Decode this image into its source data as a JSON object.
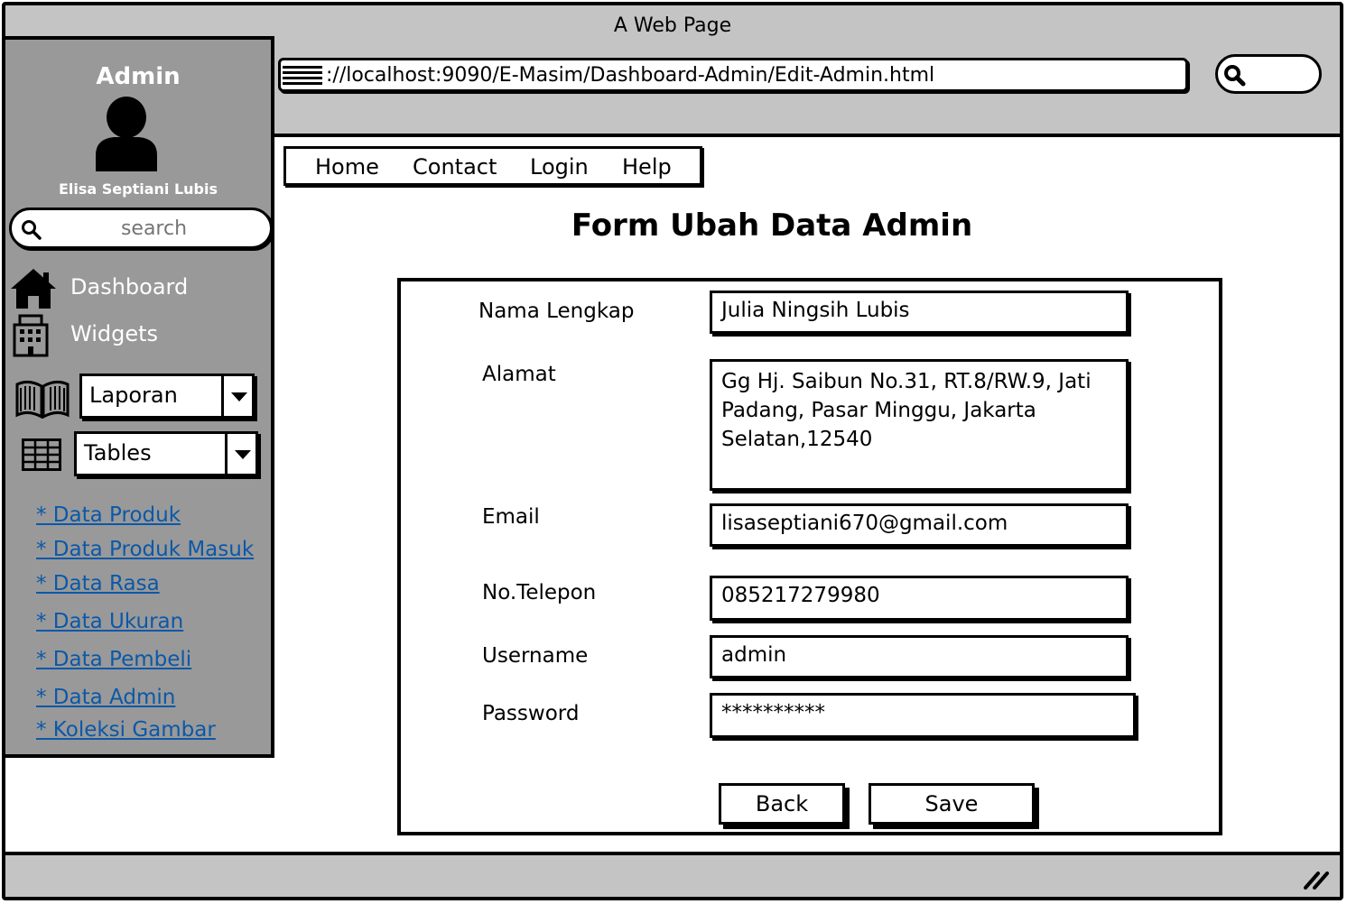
{
  "window": {
    "title": "A Web Page"
  },
  "browser": {
    "url": "http://localhost:9090/E-Masim/Dashboard-Admin/Edit-Admin.html",
    "url_visible": "://localhost:9090/E-Masim/Dashboard-Admin/Edit-Admin.html"
  },
  "sidebar": {
    "title": "Admin",
    "user_name": "Elisa Septiani Lubis",
    "search_placeholder": "search",
    "nav": [
      {
        "label": "Dashboard",
        "icon": "home-icon"
      },
      {
        "label": "Widgets",
        "icon": "building-icon"
      }
    ],
    "dropdowns": [
      {
        "label": "Laporan",
        "icon": "book-icon"
      },
      {
        "label": "Tables",
        "icon": "table-icon"
      }
    ],
    "links": [
      "* Data Produk",
      "* Data Produk Masuk",
      "* Data Rasa",
      "* Data Ukuran",
      "* Data Pembeli",
      "* Data Admin",
      "* Koleksi Gambar"
    ]
  },
  "menu": [
    "Home",
    "Contact",
    "Login",
    "Help"
  ],
  "form": {
    "title": "Form Ubah Data Admin",
    "fields": [
      {
        "label": "Nama Lengkap",
        "value": "Julia Ningsih Lubis"
      },
      {
        "label": "Alamat",
        "value": "Gg Hj. Saibun No.31, RT.8/RW.9, Jati Padang, Pasar Minggu, Jakarta Selatan,12540"
      },
      {
        "label": "Email",
        "value": "lisaseptiani670@gmail.com"
      },
      {
        "label": "No.Telepon",
        "value": "085217279980"
      },
      {
        "label": "Username",
        "value": "admin"
      },
      {
        "label": "Password",
        "value": "**********"
      }
    ],
    "buttons": {
      "back": "Back",
      "save": "Save"
    }
  }
}
